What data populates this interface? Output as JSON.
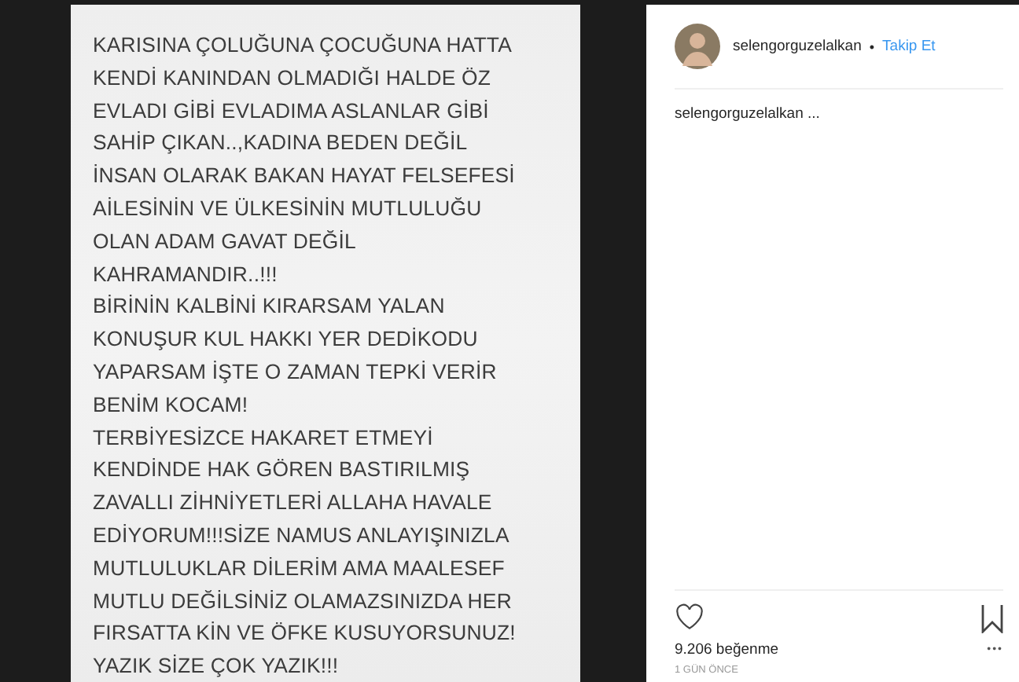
{
  "post_image": {
    "lines": [
      "KARISINA ÇOLUĞUNA ÇOCUĞUNA HATTA",
      "KENDİ KANINDAN OLMADIĞI HALDE ÖZ",
      "EVLADI GİBİ EVLADIMA ASLANLAR GİBİ",
      "SAHİP ÇIKAN..,KADINA BEDEN  DEĞİL",
      "İNSAN OLARAK BAKAN HAYAT FELSEFESİ",
      "AİLESİNİN VE ÜLKESİNİN MUTLULUĞU",
      "OLAN ADAM GAVAT DEĞİL",
      "KAHRAMANDIR..!!!",
      "BİRİNİN KALBİNİ KIRARSAM YALAN",
      "KONUŞUR KUL HAKKI YER DEDİKODU",
      "YAPARSAM İŞTE O ZAMAN TEPKİ VERİR",
      "BENİM KOCAM!",
      "TERBİYESİZCE HAKARET ETMEYİ",
      "KENDİNDE HAK GÖREN BASTIRILMIŞ",
      "ZAVALLI ZİHNİYETLERİ ALLAHA HAVALE",
      "EDİYORUM!!!SİZE NAMUS ANLAYIŞINIZLA",
      "MUTLULUKLAR DİLERİM AMA MAALESEF",
      "MUTLU DEĞİLSİNİZ OLAMAZSINIZDA HER",
      "FIRSATTA KİN VE ÖFKE KUSUYORSUNUZ!",
      "YAZIK SİZE ÇOK YAZIK!!!"
    ]
  },
  "header": {
    "username": "selengorguzelalkan",
    "separator": "•",
    "follow": "Takip Et"
  },
  "caption": "selengorguzelalkan ...",
  "actions": {
    "liked": false,
    "saved": false
  },
  "likes": "9.206 beğenme",
  "more": "•••",
  "time": "1 GÜN ÖNCE"
}
